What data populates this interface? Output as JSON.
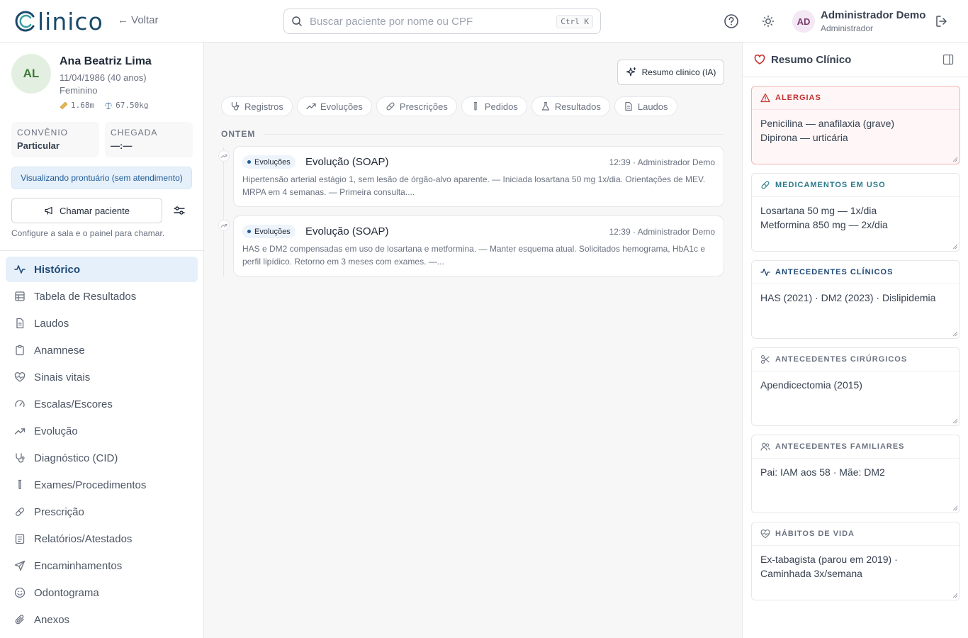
{
  "topbar": {
    "logo_text": "linico",
    "back_label": "← Voltar",
    "search_placeholder": "Buscar paciente por nome ou CPF",
    "search_shortcut": "Ctrl K",
    "user_initials": "AD",
    "user_name": "Administrador Demo",
    "user_role": "Administrador",
    "icons": [
      "help-circle-icon",
      "sun-icon",
      "logout-icon"
    ]
  },
  "patient": {
    "initials": "AL",
    "name": "Ana Beatriz Lima",
    "dob": "11/04/1986 (40 anos)",
    "sex": "Feminino",
    "height": "1.68m",
    "weight": "67.50kg",
    "insurance_label": "CONVÊNIO",
    "insurance_value": "Particular",
    "arrival_label": "CHEGADA",
    "arrival_value": "—:—",
    "viewing_notice": "Visualizando prontuário (sem atendimento)",
    "call_label": "Chamar paciente",
    "call_hint": "Configure a sala e o painel para chamar."
  },
  "nav": [
    {
      "label": "Histórico",
      "icon": "activity-icon",
      "active": true
    },
    {
      "label": "Tabela de Resultados",
      "icon": "table-icon"
    },
    {
      "label": "Laudos",
      "icon": "document-icon"
    },
    {
      "label": "Anamnese",
      "icon": "clipboard-icon"
    },
    {
      "label": "Sinais vitais",
      "icon": "heart-pulse-icon"
    },
    {
      "label": "Escalas/Escores",
      "icon": "gauge-icon"
    },
    {
      "label": "Evolução",
      "icon": "trend-up-icon"
    },
    {
      "label": "Diagnóstico (CID)",
      "icon": "stethoscope-icon"
    },
    {
      "label": "Exames/Procedimentos",
      "icon": "test-tube-icon"
    },
    {
      "label": "Prescrição",
      "icon": "pill-icon"
    },
    {
      "label": "Relatórios/Atestados",
      "icon": "report-icon"
    },
    {
      "label": "Encaminhamentos",
      "icon": "send-icon"
    },
    {
      "label": "Odontograma",
      "icon": "smile-icon"
    },
    {
      "label": "Anexos",
      "icon": "paperclip-icon"
    }
  ],
  "main": {
    "ai_button": "Resumo clínico (IA)",
    "filters": [
      "Registros",
      "Evoluções",
      "Prescrições",
      "Pedidos",
      "Resultados",
      "Laudos"
    ],
    "day_label": "ONTEM",
    "entries": [
      {
        "badge": "Evoluções",
        "title": "Evolução (SOAP)",
        "meta": "12:39 · Administrador Demo",
        "text": "Hipertensão arterial estágio 1, sem lesão de órgão-alvo aparente. — Iniciada losartana 50 mg 1x/dia. Orientações de MEV. MRPA em 4 semanas. — Primeira consulta...."
      },
      {
        "badge": "Evoluções",
        "title": "Evolução (SOAP)",
        "meta": "12:39 · Administrador Demo",
        "text": "HAS e DM2 compensadas em uso de losartana e metformina. — Manter esquema atual. Solicitados hemograma, HbA1c e perfil lipídico. Retorno em 3 meses com exames. —..."
      }
    ]
  },
  "summary": {
    "title": "Resumo Clínico",
    "cards": [
      {
        "title": "ALERGIAS",
        "lines": [
          "Penicilina — anafilaxia (grave)",
          "Dipirona — urticária"
        ]
      },
      {
        "title": "MEDICAMENTOS EM USO",
        "lines": [
          "Losartana 50 mg — 1x/dia",
          "Metformina 850 mg — 2x/dia"
        ]
      },
      {
        "title": "ANTECEDENTES CLÍNICOS",
        "lines": [
          "HAS (2021) · DM2 (2023) · Dislipidemia"
        ]
      },
      {
        "title": "ANTECEDENTES CIRÚRGICOS",
        "lines": [
          "Apendicectomia (2015)"
        ]
      },
      {
        "title": "ANTECEDENTES FAMILIARES",
        "lines": [
          "Pai: IAM aos 58 · Mãe: DM2"
        ]
      },
      {
        "title": "HÁBITOS DE VIDA",
        "lines": [
          "Ex-tabagista (parou em 2019) ·",
          "Caminhada 3x/semana"
        ]
      }
    ]
  },
  "colors": {
    "brand": "#1a4a6b",
    "brand_accent": "#3aa0a0",
    "nav_active_bg": "#e6f0fa",
    "allergy": "#c53030"
  }
}
